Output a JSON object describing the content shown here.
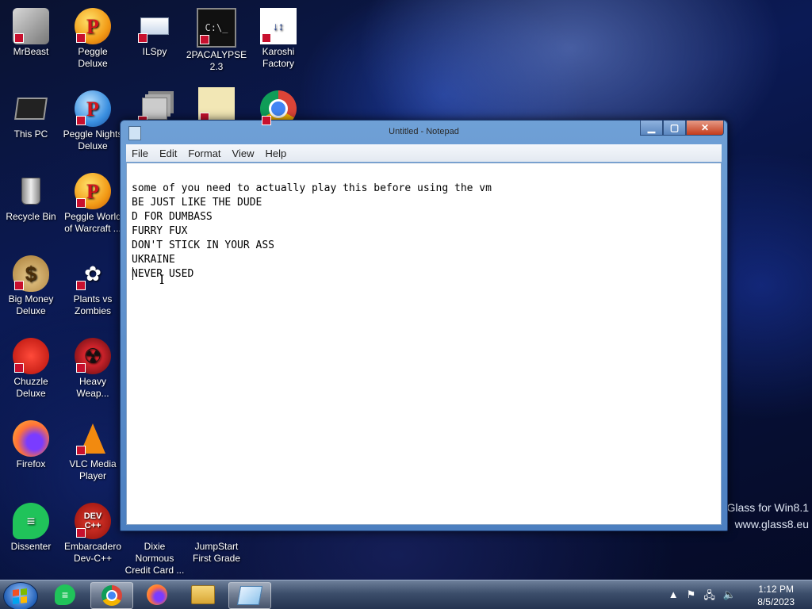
{
  "desktop_icons": [
    {
      "label": "MrBeast",
      "icon": "mrbeast-icon"
    },
    {
      "label": "Peggle Deluxe",
      "icon": "peggle-icon"
    },
    {
      "label": "ILSpy",
      "icon": "ilspy-icon"
    },
    {
      "label": "2PACALYPSE 2.3",
      "icon": "terminal-icon"
    },
    {
      "label": "Karoshi Factory",
      "icon": "karoshi-icon"
    },
    {
      "label": "This PC",
      "icon": "computer-icon"
    },
    {
      "label": "Peggle Nights Deluxe",
      "icon": "peggle-nights-icon"
    },
    {
      "label": "Recycle Bin",
      "icon": "recycle-bin-icon"
    },
    {
      "label": "Peggle World of Warcraft ...",
      "icon": "peggle-wow-icon"
    },
    {
      "label": "Big Money Deluxe",
      "icon": "money-bag-icon"
    },
    {
      "label": "Plants vs Zombies",
      "icon": "plants-vs-zombies-icon"
    },
    {
      "label": "Chuzzle Deluxe",
      "icon": "chuzzle-icon"
    },
    {
      "label": "Heavy Weap...",
      "icon": "heavy-weapon-icon"
    },
    {
      "label": "Firefox",
      "icon": "firefox-icon"
    },
    {
      "label": "VLC Media Player",
      "icon": "vlc-icon"
    },
    {
      "label": "Dissenter",
      "icon": "dissenter-icon"
    },
    {
      "label": "Embarcadero Dev-C++",
      "icon": "devcpp-icon"
    },
    {
      "label": "Dixie Normous Credit Card ...",
      "icon": "credit-card-icon"
    },
    {
      "label": "JumpStart First Grade",
      "icon": "jumpstart-icon"
    }
  ],
  "notepad": {
    "title": "Untitled - Notepad",
    "menu": [
      "File",
      "Edit",
      "Format",
      "View",
      "Help"
    ],
    "lines": [
      "some of you need to actually play this before using the vm",
      "BE JUST LIKE THE DUDE",
      "D FOR DUMBASS",
      "FURRY FUX",
      "DON'T STICK IN YOUR ASS",
      "UKRAINE",
      "NEVER USED",
      ""
    ]
  },
  "watermark": {
    "line1": "Glass for Win8.1",
    "line2": "www.glass8.eu"
  },
  "taskbar": {
    "pinned": [
      "start-icon",
      "dissenter-icon",
      "chrome-icon",
      "firefox-icon",
      "file-explorer-icon",
      "notepad-icon"
    ],
    "active": "notepad-icon",
    "time": "1:12 PM",
    "date": "8/5/2023"
  }
}
